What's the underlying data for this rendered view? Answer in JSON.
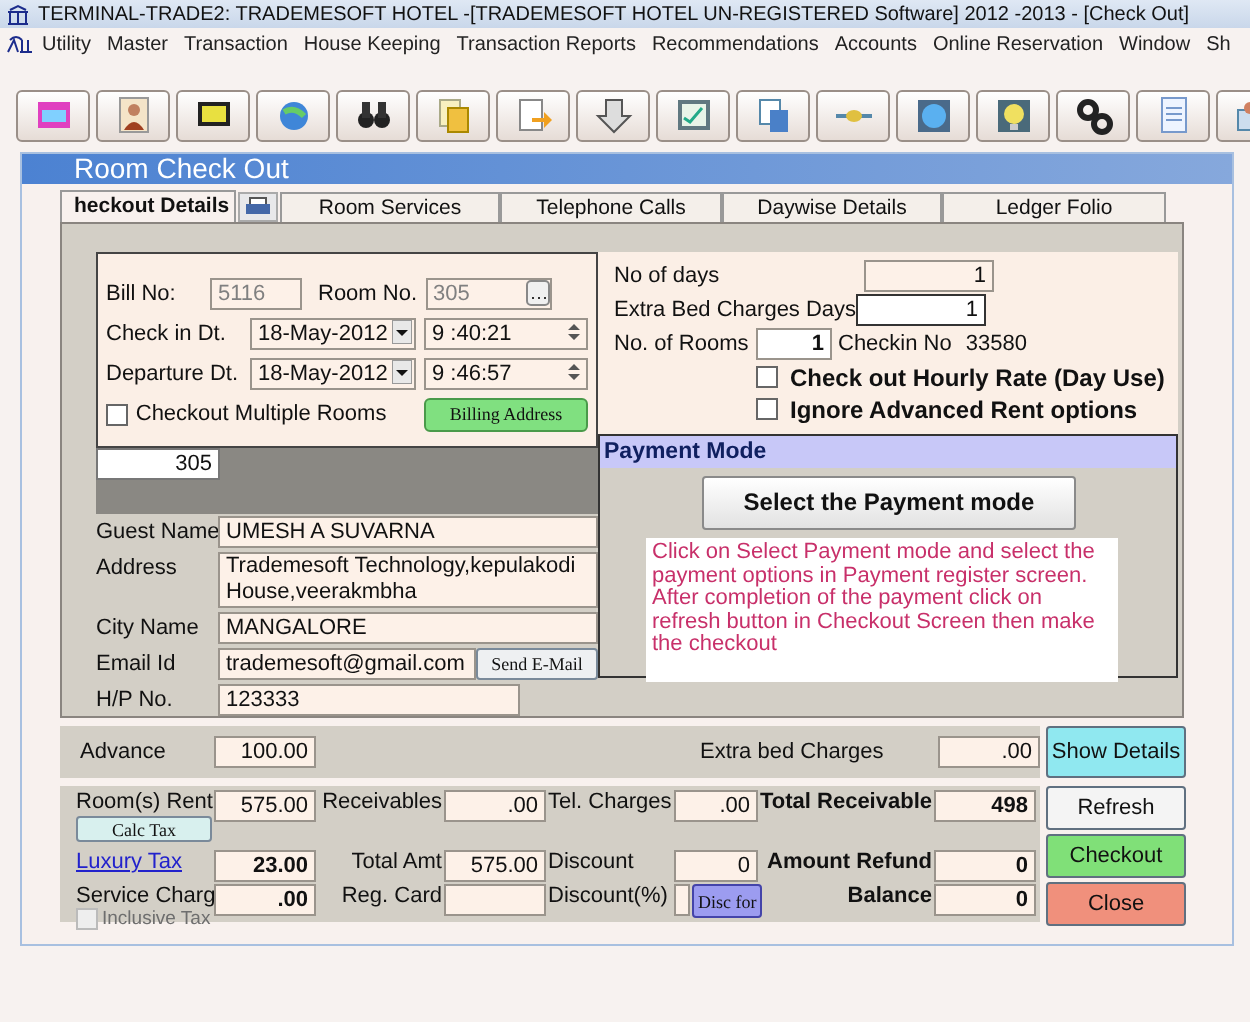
{
  "window": {
    "title": "TERMINAL-TRADE2: TRADEMESOFT HOTEL -[TRADEMESOFT HOTEL UN-REGISTERED Software] 2012 -2013 - [Check Out]"
  },
  "menu": [
    "Utility",
    "Master",
    "Transaction",
    "House Keeping",
    "Transaction Reports",
    "Recommendations",
    "Accounts",
    "Online Reservation",
    "Window",
    "Sh"
  ],
  "panel": {
    "title": "Room Check Out"
  },
  "tabs": [
    {
      "label": "heckout Details",
      "selected": true
    },
    {
      "label": "Room Services",
      "selected": false
    },
    {
      "label": "Telephone Calls",
      "selected": false
    },
    {
      "label": "Daywise Details",
      "selected": false
    },
    {
      "label": "Ledger Folio",
      "selected": false
    }
  ],
  "bill": {
    "bill_no_label": "Bill No:",
    "bill_no": "5116",
    "room_no_label": "Room No.",
    "room_no": "305",
    "check_in_label": "Check in Dt.",
    "check_in_date": "18-May-2012",
    "check_in_time": "9 :40:21",
    "departure_label": "Departure Dt.",
    "departure_date": "18-May-2012",
    "departure_time": "9 :46:57",
    "multiple_rooms": {
      "label": "Checkout Multiple Rooms",
      "checked": false
    },
    "billing_address_button": "Billing Address"
  },
  "rooms": [
    "305"
  ],
  "guest": [
    {
      "label": "Guest Name",
      "value": "UMESH A SUVARNA"
    },
    {
      "label": "Address",
      "value": " Trademesoft Technology,kepulakodi House,veerakmbha",
      "kind": "multiline"
    },
    {
      "label": "City Name",
      "value": "MANGALORE"
    },
    {
      "label": "Email Id",
      "value": "trademesoft@gmail.com",
      "button": "Send E-Mail"
    },
    {
      "label": "H/P No.",
      "value": "123333",
      "kind": "short"
    }
  ],
  "stay": {
    "days_label": "No of days",
    "days": "1",
    "extra_bed_label": "Extra Bed Charges Days",
    "extra_bed": "1",
    "rooms_label": "No. of Rooms",
    "rooms": "1",
    "checkin_no_label": "Checkin No",
    "checkin_no": "33580"
  },
  "options": [
    {
      "label": "Check out Hourly Rate (Day Use)",
      "checked": false
    },
    {
      "label": "Ignore Advanced Rent options",
      "checked": false
    }
  ],
  "payment": {
    "title": "Payment Mode",
    "button": "Select the Payment mode",
    "note": "Click on Select Payment mode and select the payment options in Payment register screen. After completion of the payment click on refresh button in Checkout Screen then make the checkout"
  },
  "advance": {
    "label": "Advance",
    "value": "100.00",
    "extra_bed_label": "Extra bed Charges",
    "extra_bed": ".00"
  },
  "totals": [
    [
      {
        "label": "Room(s) Rent",
        "value": "575.00",
        "button": "Calc Tax"
      },
      {
        "label": "Receivables",
        "value": ".00"
      },
      {
        "label": "Tel. Charges",
        "value": ".00"
      },
      {
        "label": "Total Receivable",
        "value": "498",
        "emphasis": true
      }
    ],
    [
      {
        "label": "Luxury Tax",
        "value": "23.00",
        "kind": "link",
        "emphasis": true
      },
      {
        "label": "Total Amt",
        "value": "575.00"
      },
      {
        "label": "Discount",
        "value": "0"
      },
      {
        "label": "Amount Refund",
        "value": "0",
        "emphasis": true
      }
    ],
    [
      {
        "label": "Service Charg",
        "value": ".00",
        "emphasis": true,
        "checkbox": {
          "label": "Inclusive Tax",
          "checked": false,
          "disabled": true
        }
      },
      {
        "label": "Reg. Card"
      },
      {
        "label": "Discount(%)",
        "button": "Disc for"
      },
      {
        "label": "Balance",
        "value": "0",
        "emphasis": true
      }
    ]
  ],
  "actions": [
    {
      "label": "Show Details",
      "color": "#90e8f0"
    },
    {
      "label": "Refresh",
      "color": "#f4f4f4"
    },
    {
      "label": "Checkout",
      "color": "#80e078"
    },
    {
      "label": "Close",
      "color": "#f0907c"
    }
  ]
}
